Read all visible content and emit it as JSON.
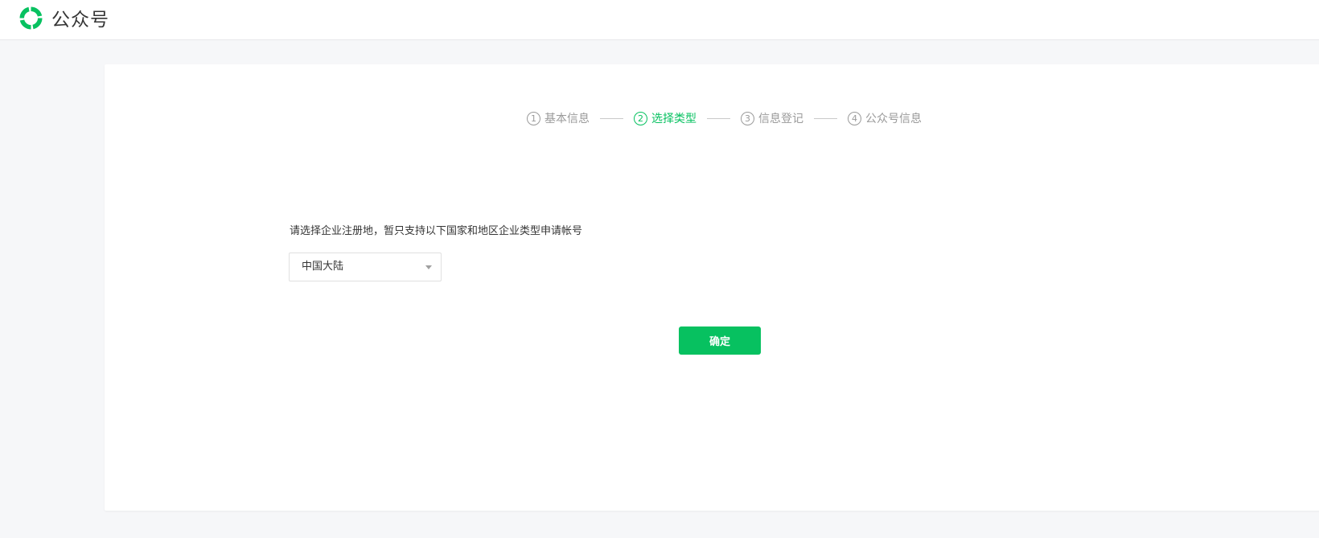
{
  "header": {
    "app_title": "公众号",
    "logo_icon": "wechat-official-account-logo",
    "brand_color": "#07c160"
  },
  "steps": [
    {
      "number": "1",
      "label": "基本信息",
      "active": false
    },
    {
      "number": "2",
      "label": "选择类型",
      "active": true
    },
    {
      "number": "3",
      "label": "信息登记",
      "active": false
    },
    {
      "number": "4",
      "label": "公众号信息",
      "active": false
    }
  ],
  "form": {
    "prompt": "请选择企业注册地，暂只支持以下国家和地区企业类型申请帐号",
    "region_select": {
      "selected": "中国大陆",
      "caret_icon": "caret-down-icon"
    },
    "confirm_label": "确定"
  }
}
